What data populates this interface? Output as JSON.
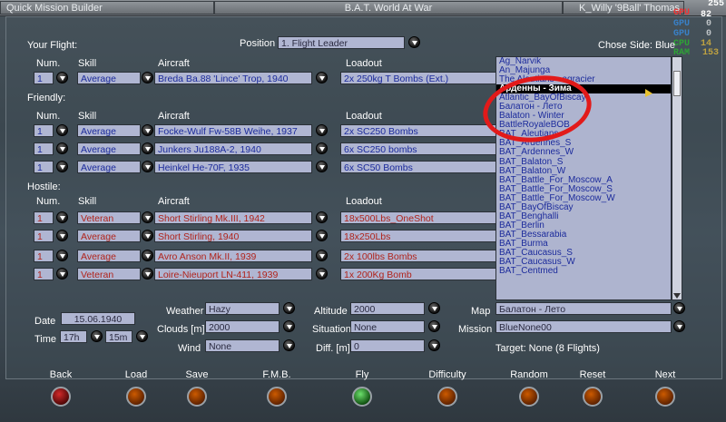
{
  "tabs": {
    "left": "Quick Mission Builder",
    "center": "B.A.T. World At War",
    "right": "K_Willy '9Ball' Thomas"
  },
  "osd": {
    "fps": "255",
    "a": "82",
    "b": "0",
    "c": "0",
    "d": "14",
    "e": "153",
    "labels": [
      "GPU",
      "GPU",
      "GPU",
      "GPU",
      "CPU",
      "RAM"
    ]
  },
  "your_flight": {
    "label": "Your Flight:",
    "position_label": "Position",
    "position_value": "1. Flight Leader",
    "chose_side": "Chose Side: Blue"
  },
  "headers": {
    "num": "Num.",
    "skill": "Skill",
    "aircraft": "Aircraft",
    "loadout": "Loadout"
  },
  "flight_rows": [
    {
      "num": "1",
      "skill": "Average",
      "aircraft": "Breda Ba.88 'Lince' Trop, 1940",
      "loadout": "2x 250kg T Bombs (Ext.)"
    }
  ],
  "friendly": {
    "label": "Friendly:",
    "rows": [
      {
        "num": "1",
        "skill": "Average",
        "aircraft": "Focke-Wulf Fw-58B Weihe, 1937",
        "loadout": "2x SC250 Bombs"
      },
      {
        "num": "1",
        "skill": "Average",
        "aircraft": "Junkers Ju188A-2, 1940",
        "loadout": "6x SC250 bombs"
      },
      {
        "num": "1",
        "skill": "Average",
        "aircraft": "Heinkel He-70F, 1935",
        "loadout": "6x SC50 Bombs"
      }
    ]
  },
  "hostile": {
    "label": "Hostile:",
    "rows": [
      {
        "num": "1",
        "skill": "Veteran",
        "aircraft": "Short Stirling Mk.III, 1942",
        "loadout": "18x500Lbs_OneShot"
      },
      {
        "num": "1",
        "skill": "Average",
        "aircraft": "Short Stirling, 1940",
        "loadout": "18x250Lbs"
      },
      {
        "num": "1",
        "skill": "Average",
        "aircraft": "Avro Anson Mk.II, 1939",
        "loadout": "2x 100lbs Bombs"
      },
      {
        "num": "1",
        "skill": "Veteran",
        "aircraft": "Loire-Nieuport LN-411, 1939",
        "loadout": "1x 200Kg Bomb"
      }
    ]
  },
  "map_list": {
    "items": [
      "Ag_Narvik",
      "An_Majunga",
      "The Aleutians - agracier",
      "Арденны - Зима",
      "Atlantic_BayOfBiscay",
      "Балатон - Лето",
      "Balaton - Winter",
      "BattleRoyaleBOB",
      "BAT_Aleutians",
      "BAT_Ardennes_S",
      "BAT_Ardennes_W",
      "BAT_Balaton_S",
      "BAT_Balaton_W",
      "BAT_Battle_For_Moscow_A",
      "BAT_Battle_For_Moscow_S",
      "BAT_Battle_For_Moscow_W",
      "BAT_BayOfBiscay",
      "BAT_Benghalli",
      "BAT_Berlin",
      "BAT_Bessarabia",
      "BAT_Burma",
      "BAT_Caucasus_S",
      "BAT_Caucasus_W",
      "BAT_Centmed"
    ],
    "selected_index": 3
  },
  "bottom": {
    "date_label": "Date",
    "date": "15.06.1940",
    "time_label": "Time",
    "hour": "17h",
    "minute": "15m",
    "weather_label": "Weather",
    "weather": "Hazy",
    "clouds_label": "Clouds [m]",
    "clouds": "2000",
    "wind_label": "Wind",
    "wind": "None",
    "altitude_label": "Altitude",
    "altitude": "2000",
    "situation_label": "Situation",
    "situation": "None",
    "diff_label": "Diff. [m]",
    "diff": "0",
    "map_label": "Map",
    "map": "Балатон - Лето",
    "mission_label": "Mission",
    "mission": "BlueNone00",
    "target": "Target: None (8 Flights)"
  },
  "buttons": [
    {
      "label": "Back",
      "lamp": "red"
    },
    {
      "label": "Load",
      "lamp": "orange"
    },
    {
      "label": "Save",
      "lamp": "orange"
    },
    {
      "label": "F.M.B.",
      "lamp": "orange"
    },
    {
      "label": "Fly",
      "lamp": "green"
    },
    {
      "label": "Difficulty",
      "lamp": "orange"
    },
    {
      "label": "Random",
      "lamp": "orange"
    },
    {
      "label": "Reset",
      "lamp": "orange"
    },
    {
      "label": "Next",
      "lamp": "orange"
    }
  ]
}
